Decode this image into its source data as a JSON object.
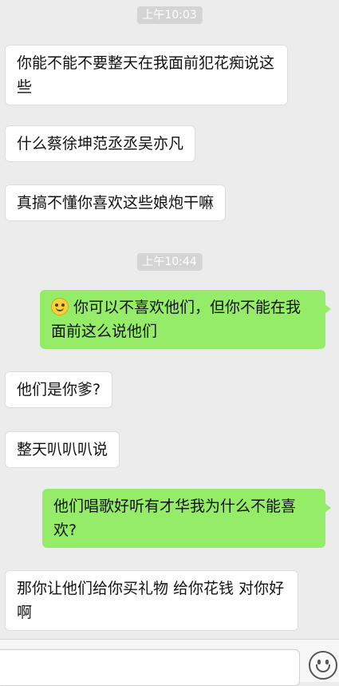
{
  "timestamps": [
    "上午10:03",
    "上午10:44"
  ],
  "messages": [
    {
      "side": "left",
      "text": "你能不能不要整天在我面前犯花痴说这些"
    },
    {
      "side": "left",
      "text": "什么蔡徐坤范丞丞吴亦凡"
    },
    {
      "side": "left",
      "text": "真搞不懂你喜欢这些娘炮干嘛"
    },
    {
      "side": "right",
      "emoji": "smile-emoji",
      "text": "你可以不喜欢他们，但你不能在我面前这么说他们"
    },
    {
      "side": "left",
      "text": "他们是你爹?"
    },
    {
      "side": "left",
      "text": "整天叭叭叭说"
    },
    {
      "side": "right",
      "text": "他们唱歌好听有才华我为什么不能喜欢?"
    },
    {
      "side": "left",
      "text": "那你让他们给你买礼物 给你花钱 对你好啊"
    }
  ],
  "colors": {
    "sent_bubble": "#95ec69",
    "received_bubble": "#ffffff",
    "background": "#ececec"
  },
  "input_bar": {
    "icon": "emoji-face-icon"
  }
}
